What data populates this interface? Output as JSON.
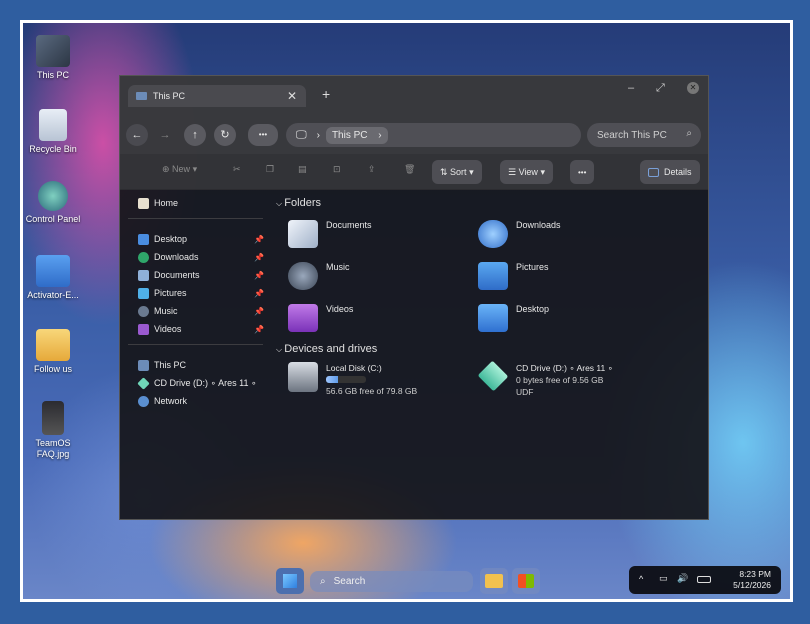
{
  "desktop": {
    "icons": [
      {
        "label": "This PC"
      },
      {
        "label": "Recycle Bin"
      },
      {
        "label": "Control Panel"
      },
      {
        "label": "Activator-E..."
      },
      {
        "label": "Follow us"
      },
      {
        "label": "TeamOS FAQ.jpg"
      }
    ]
  },
  "window": {
    "tab_title": "This PC",
    "tab_close": "✕",
    "new_tab": "+",
    "controls": {
      "minimize": "–",
      "maximize": "⤢",
      "close": "✕"
    }
  },
  "address": {
    "back": "←",
    "forward": "→",
    "up": "↑",
    "refresh": "↻",
    "more": "•••",
    "computer_glyph": "🖵",
    "separator": "›",
    "crumb": "This PC",
    "search_placeholder": "Search This PC",
    "search_glyph": "⌕"
  },
  "toolbar": {
    "new_label": "New",
    "sort_label": "Sort",
    "view_label": "View",
    "more_label": "•••",
    "details_label": "Details"
  },
  "sidebar": {
    "home": "Home",
    "quick_access": [
      {
        "label": "Desktop"
      },
      {
        "label": "Downloads"
      },
      {
        "label": "Documents"
      },
      {
        "label": "Pictures"
      },
      {
        "label": "Music"
      },
      {
        "label": "Videos"
      }
    ],
    "locations": [
      {
        "label": "This PC"
      },
      {
        "label": "CD Drive (D:) ∘ Ares 11 ∘"
      },
      {
        "label": "Network"
      }
    ]
  },
  "content": {
    "folders_heading": "Folders",
    "folders": [
      {
        "label": "Documents"
      },
      {
        "label": "Downloads"
      },
      {
        "label": "Music"
      },
      {
        "label": "Pictures"
      },
      {
        "label": "Videos"
      },
      {
        "label": "Desktop"
      }
    ],
    "drives_heading": "Devices and drives",
    "drives": [
      {
        "label": "Local Disk (C:)",
        "free_text": "56.6 GB free of 79.8 GB",
        "used_fraction": 0.29
      },
      {
        "label": "CD Drive (D:) ∘ Ares 11 ∘",
        "free_text": "0 bytes free of 9.56 GB",
        "fs": "UDF"
      }
    ]
  },
  "taskbar": {
    "search_label": "Search",
    "time": "8:23 PM",
    "date": "5/12/2026",
    "tray_chevron": "^"
  },
  "colors": {
    "window_bg": "#16161a",
    "toolbar_bg": "#343438",
    "accent": "#5f9be8",
    "folder_blue": "#3f82d8",
    "folder_yellow": "#f2c14e"
  }
}
